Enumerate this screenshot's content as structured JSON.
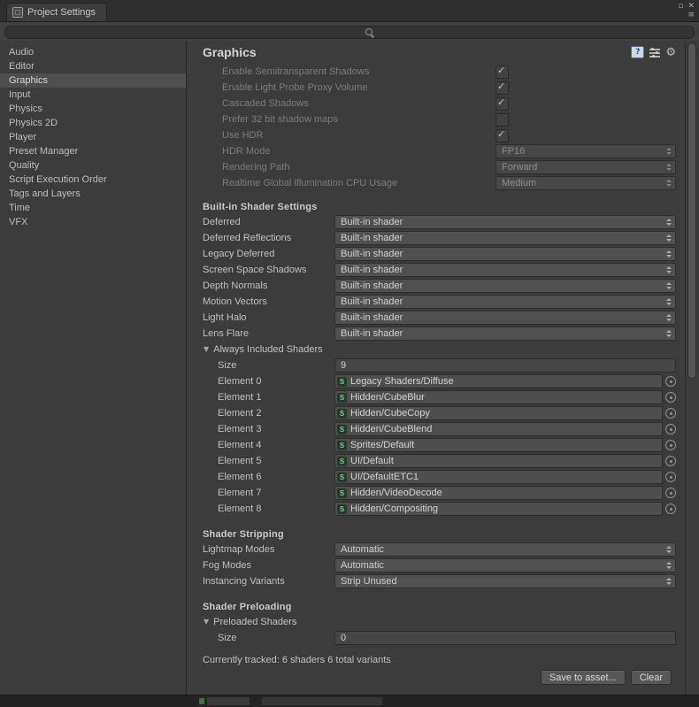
{
  "window": {
    "title": "Project Settings"
  },
  "icons": {
    "minimize": "▫",
    "close": "✕",
    "menu": "≡",
    "foldout_open": "▼",
    "check": "✓",
    "gear": "⚙",
    "help": "?",
    "shader_letter": "S"
  },
  "colors": {
    "panel": "#3c3c3c",
    "selection": "#4f4f4f",
    "field": "#515151",
    "disabled_text": "#7d7d7d",
    "shader_icon_green": "#7ecb8f"
  },
  "search": {
    "placeholder": ""
  },
  "sidebar": {
    "items": [
      {
        "label": "Audio"
      },
      {
        "label": "Editor"
      },
      {
        "label": "Graphics",
        "selected": true
      },
      {
        "label": "Input"
      },
      {
        "label": "Physics"
      },
      {
        "label": "Physics 2D"
      },
      {
        "label": "Player"
      },
      {
        "label": "Preset Manager"
      },
      {
        "label": "Quality"
      },
      {
        "label": "Script Execution Order"
      },
      {
        "label": "Tags and Layers"
      },
      {
        "label": "Time"
      },
      {
        "label": "VFX"
      }
    ]
  },
  "main": {
    "title": "Graphics",
    "tier": {
      "toggles": [
        {
          "label": "Enable Semitransparent Shadows",
          "checked": true
        },
        {
          "label": "Enable Light Probe Proxy Volume",
          "checked": true
        },
        {
          "label": "Cascaded Shadows",
          "checked": true
        },
        {
          "label": "Prefer 32 bit shadow maps",
          "checked": false
        },
        {
          "label": "Use HDR",
          "checked": true
        }
      ],
      "popups": [
        {
          "label": "HDR Mode",
          "value": "FP16"
        },
        {
          "label": "Rendering Path",
          "value": "Forward"
        },
        {
          "label": "Realtime Global Illumination CPU Usage",
          "value": "Medium"
        }
      ]
    },
    "builtin": {
      "heading": "Built-in Shader Settings",
      "rows": [
        {
          "label": "Deferred",
          "value": "Built-in shader"
        },
        {
          "label": "Deferred Reflections",
          "value": "Built-in shader"
        },
        {
          "label": "Legacy Deferred",
          "value": "Built-in shader"
        },
        {
          "label": "Screen Space Shadows",
          "value": "Built-in shader"
        },
        {
          "label": "Depth Normals",
          "value": "Built-in shader"
        },
        {
          "label": "Motion Vectors",
          "value": "Built-in shader"
        },
        {
          "label": "Light Halo",
          "value": "Built-in shader"
        },
        {
          "label": "Lens Flare",
          "value": "Built-in shader"
        }
      ],
      "always_included": {
        "label": "Always Included Shaders",
        "size_label": "Size",
        "size_value": "9",
        "elements": [
          {
            "label": "Element 0",
            "value": "Legacy Shaders/Diffuse"
          },
          {
            "label": "Element 1",
            "value": "Hidden/CubeBlur"
          },
          {
            "label": "Element 2",
            "value": "Hidden/CubeCopy"
          },
          {
            "label": "Element 3",
            "value": "Hidden/CubeBlend"
          },
          {
            "label": "Element 4",
            "value": "Sprites/Default"
          },
          {
            "label": "Element 5",
            "value": "UI/Default"
          },
          {
            "label": "Element 6",
            "value": "UI/DefaultETC1"
          },
          {
            "label": "Element 7",
            "value": "Hidden/VideoDecode"
          },
          {
            "label": "Element 8",
            "value": "Hidden/Compositing"
          }
        ]
      }
    },
    "stripping": {
      "heading": "Shader Stripping",
      "rows": [
        {
          "label": "Lightmap Modes",
          "value": "Automatic"
        },
        {
          "label": "Fog Modes",
          "value": "Automatic"
        },
        {
          "label": "Instancing Variants",
          "value": "Strip Unused"
        }
      ]
    },
    "preloading": {
      "heading": "Shader Preloading",
      "foldout_label": "Preloaded Shaders",
      "size_label": "Size",
      "size_value": "0",
      "tracked_text": "Currently tracked: 6 shaders 6 total variants",
      "save_button": "Save to asset...",
      "clear_button": "Clear"
    }
  }
}
